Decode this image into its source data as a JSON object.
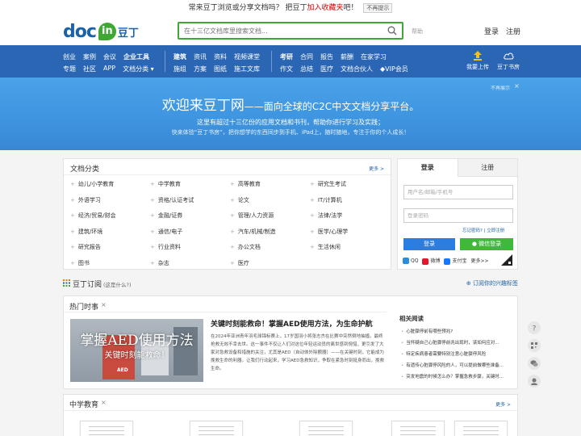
{
  "notice": {
    "text_before": "常来豆丁浏览或分享文档吗？ 把豆丁",
    "highlight": "加入收藏夹",
    "text_after": "吧！",
    "button": "不再提示"
  },
  "header": {
    "logo_doc": "doc",
    "logo_in": "in",
    "logo_cn": "豆丁",
    "search_placeholder": "在十三亿文档库里搜索文档...",
    "help": "帮助",
    "login": "登录",
    "register": "注册"
  },
  "nav": {
    "group1_row1": [
      "创业",
      "案例",
      "会议",
      "企业工具"
    ],
    "group1_row2": [
      "专题",
      "社区",
      "APP",
      "文档分类"
    ],
    "group2_row1": [
      "建筑",
      "资讯",
      "资料",
      "视频课堂"
    ],
    "group2_row2": [
      "施组",
      "方案",
      "图纸",
      "施工文库"
    ],
    "group3_row1": [
      "考研",
      "合同",
      "报告",
      "薪酬",
      "在家学习"
    ],
    "group3_row2": [
      "作文",
      "总结",
      "医疗",
      "文档合伙人",
      "VIP会员"
    ],
    "upload": "我要上传",
    "bookroom": "豆丁书房"
  },
  "hero": {
    "title": "欢迎来豆丁网",
    "subtitle": "——面向全球的C2C中文文档分享平台。",
    "line2": "这里有超过十三亿份的应用文档和书刊，帮助你进行学习及实践；",
    "line3": "快来体验“豆丁书房”，把你想学的东西同步到手机、iPad上，随时随地，专注于你的个人成长！",
    "no_more": "不再展示",
    "close": "×"
  },
  "categories": {
    "title": "文档分类",
    "more": "更多 >",
    "items": [
      "幼儿/小学教育",
      "中学教育",
      "高等教育",
      "研究生考试",
      "外语学习",
      "资格/认证考试",
      "论文",
      "IT/计算机",
      "经济/贸易/财会",
      "金融/证券",
      "管理/人力资源",
      "法律/法学",
      "建筑/环境",
      "通信/电子",
      "汽车/机械/制造",
      "医学/心理学",
      "研究报告",
      "行业资料",
      "办公文档",
      "生活休闲",
      "图书",
      "杂志",
      "医疗"
    ]
  },
  "login": {
    "tab_login": "登录",
    "tab_register": "注册",
    "username_placeholder": "用户名/邮箱/手机号",
    "password_placeholder": "登录密码",
    "forgot": "忘记密码?",
    "signup": "立即注册",
    "btn_login": "登录",
    "btn_wechat": "微信登录",
    "social": [
      "QQ",
      "微博",
      "支付宝",
      "更多>>"
    ]
  },
  "subscription": {
    "title": "豆丁订阅",
    "what": "(这是什么?)",
    "right": "订阅你的兴趣标签"
  },
  "hot": {
    "title": "热门时事",
    "close": "×",
    "img_big": "掌握AED使用方法",
    "img_small": "关键时刻能救命！",
    "img_aed": "AED",
    "article_title": "关键时刻能救命！掌握AED使用方法，为生命护航",
    "article_body": "在2024年亚洲青年羽毛球锦标赛上，17岁国羽小将张志杰在比赛中突然倒地抽搐，最终抢救无效不幸去世。这一事件不仅让人们对这位年轻运动员的离世感到惋惜，更引发了大家对急救设备和措施的关注，尤其是AED（自动体外除颤器）——在关键时刻，它能成为挽救生命的利器。让我们行动起来，学习AED急救知识，争取在紧急时刻挺身而出，挽救生命。",
    "related_title": "相关阅读",
    "related": [
      "心脏骤停前有哪些预兆?",
      "当怀疑自己心脏骤停前兆出现时，该如何应对...",
      "特定疾病患者需要特别注意心脏骤停风险",
      "有遗传心脏骤停风险的人，可以提前做哪些准备...",
      "突发地震的时候怎么办？掌握急救步骤，关键时..."
    ]
  },
  "mid": {
    "title": "中学教育",
    "close": "×",
    "more": "更多 >"
  },
  "colors": {
    "brand_blue": "#2a66b3",
    "brand_green": "#3fa834",
    "hero_blue": "#3e94df"
  }
}
